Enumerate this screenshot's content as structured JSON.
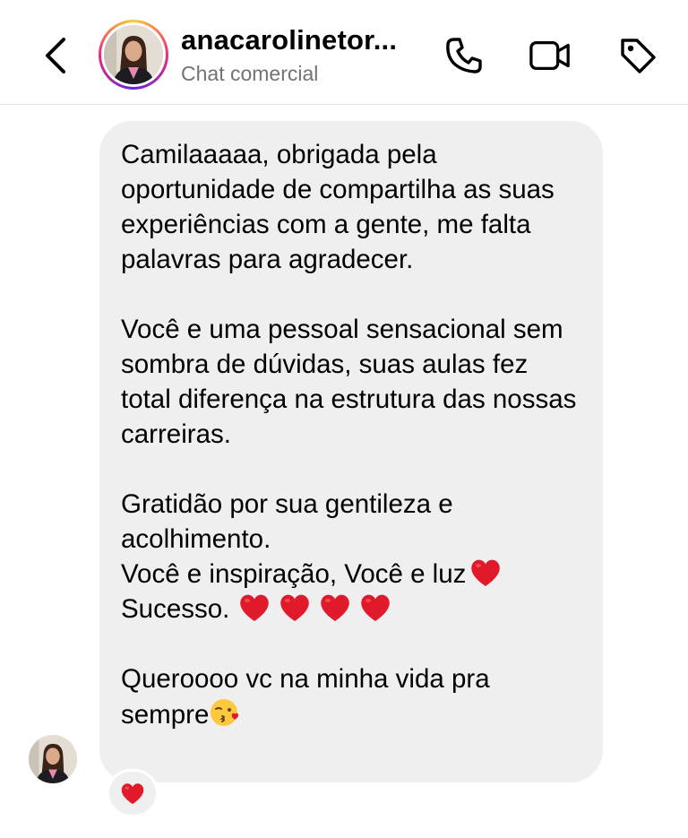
{
  "header": {
    "username": "anacarolinetor...",
    "subtitle": "Chat comercial",
    "icons": {
      "back": "chevron-left-icon",
      "call": "phone-icon",
      "video": "video-camera-icon",
      "tag": "tag-icon"
    }
  },
  "message": {
    "paragraph1": "Camilaaaaa, obrigada pela oportunidade de compartilha as suas experiências com a gente, me falta palavras para agradecer.",
    "paragraph2": "Você e uma pessoal sensacional sem sombra de dúvidas, suas aulas fez total diferença na estrutura das nossas carreiras.",
    "paragraph3": "Gratidão por sua gentileza e acolhimento.",
    "line4": "Você e inspiração, Você  e luz",
    "line5": "Sucesso.",
    "paragraph4": "Queroooo vc na minha vida pra sempre",
    "emojis": {
      "after_line4": "red-heart",
      "after_line5": [
        "red-heart",
        "red-heart",
        "red-heart",
        "red-heart"
      ],
      "after_paragraph4": "face-blowing-a-kiss"
    },
    "reaction": "red-heart"
  },
  "colors": {
    "bubble": "#efefef",
    "subtitle": "#737373",
    "heart": "#e0192b",
    "story_ring": [
      "#f9ce34",
      "#ee2a7b",
      "#6228d7"
    ]
  }
}
